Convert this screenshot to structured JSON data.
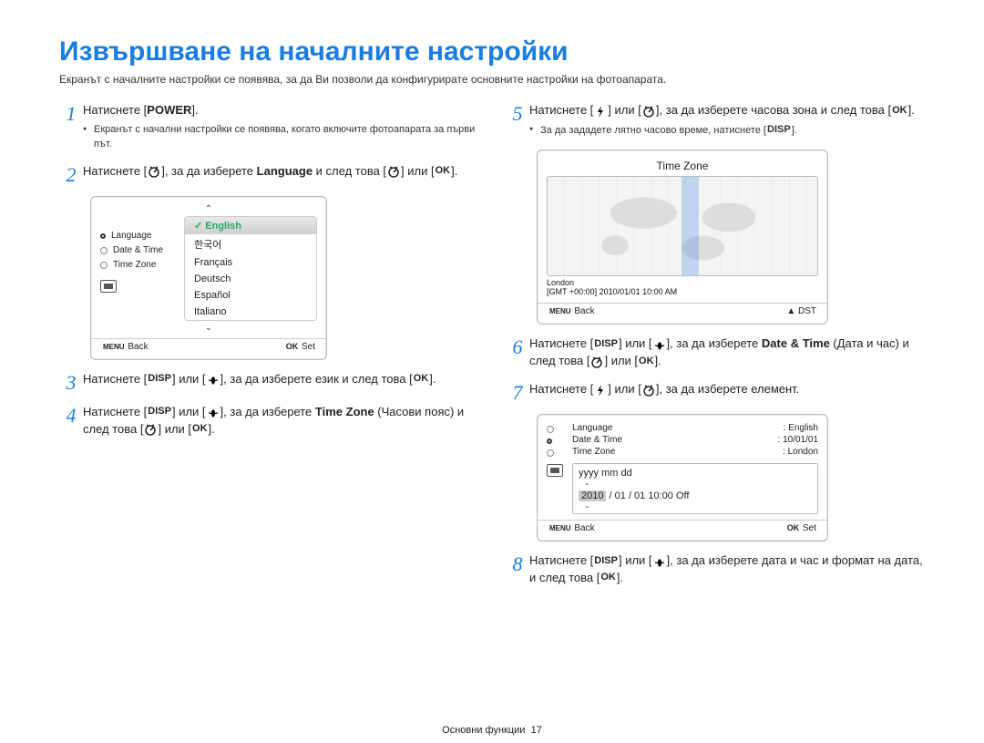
{
  "page": {
    "title": "Извършване на началните настройки",
    "intro": "Екранът с началните настройки се появява, за да Ви позволи да конфигурирате основните настройки на фотоапарата.",
    "footer_section": "Основни функции",
    "footer_page": "17"
  },
  "icons": {
    "timer": "t",
    "flash": "F",
    "disp": "DISP",
    "macro": "M",
    "ok": "OK",
    "menu": "MENU",
    "up": "▲"
  },
  "steps_left": {
    "s1": {
      "text_a": "Натиснете [",
      "text_b": "].",
      "power": "POWER",
      "sub": "Екранът с начални настройки се появява, когато включите фотоапарата за първи път."
    },
    "s2": {
      "text_a": "Натиснете [",
      "text_b": "], за да изберете ",
      "lang": "Language",
      "text_c": " и след това [",
      "text_d": "] или [",
      "text_e": "]."
    },
    "s3": {
      "text_a": "Натиснете [",
      "text_b": "] или [",
      "text_c": "], за да изберете език и след това [",
      "text_d": "]."
    },
    "s4": {
      "text_a": "Натиснете [",
      "text_b": "] или [",
      "text_c": "], за да изберете ",
      "tz": "Time Zone",
      "text_d": " (Часови пояс) и след това [",
      "text_e": "] или [",
      "text_f": "]."
    }
  },
  "steps_right": {
    "s5": {
      "text_a": "Натиснете [",
      "text_b": "] или [",
      "text_c": "], за да изберете часова зона и след това [",
      "text_d": "].",
      "sub_a": "За да зададете лятно часово време, натиснете [",
      "sub_b": "]."
    },
    "s6": {
      "text_a": "Натиснете [",
      "text_b": "] или [",
      "text_c": "], за да изберете ",
      "dt": "Date & Time",
      "text_d": " (Дата и час) и след това [",
      "text_e": "] или [",
      "text_f": "]."
    },
    "s7": {
      "text_a": "Натиснете [",
      "text_b": "] или [",
      "text_c": "], за да изберете елемент."
    },
    "s8": {
      "text_a": "Натиснете [",
      "text_b": "] или [",
      "text_c": "], за да изберете дата и час и формат на дата, и след това [",
      "text_d": "]."
    }
  },
  "lang_panel": {
    "menu": {
      "language": "Language",
      "date_time": "Date & Time",
      "time_zone": "Time Zone"
    },
    "options": [
      "English",
      "한국어",
      "Français",
      "Deutsch",
      "Español",
      "Italiano"
    ],
    "footer_back": "Back",
    "footer_set": "Set"
  },
  "tz_panel": {
    "title": "Time Zone",
    "city": "London",
    "stamp": "[GMT +00:00] 2010/01/01 10:00 AM",
    "footer_back": "Back",
    "footer_dst": "DST"
  },
  "dt_panel": {
    "labels": {
      "language": "Language",
      "date_time": "Date & Time",
      "time_zone": "Time Zone"
    },
    "values": {
      "language": ": English",
      "date_time": ": 10/01/01",
      "time_zone": ": London"
    },
    "format_header": "yyyy  mm   dd",
    "format_row_year": "2010",
    "format_row_rest": " / 01 / 01   10:00   Off",
    "footer_back": "Back",
    "footer_set": "Set"
  }
}
